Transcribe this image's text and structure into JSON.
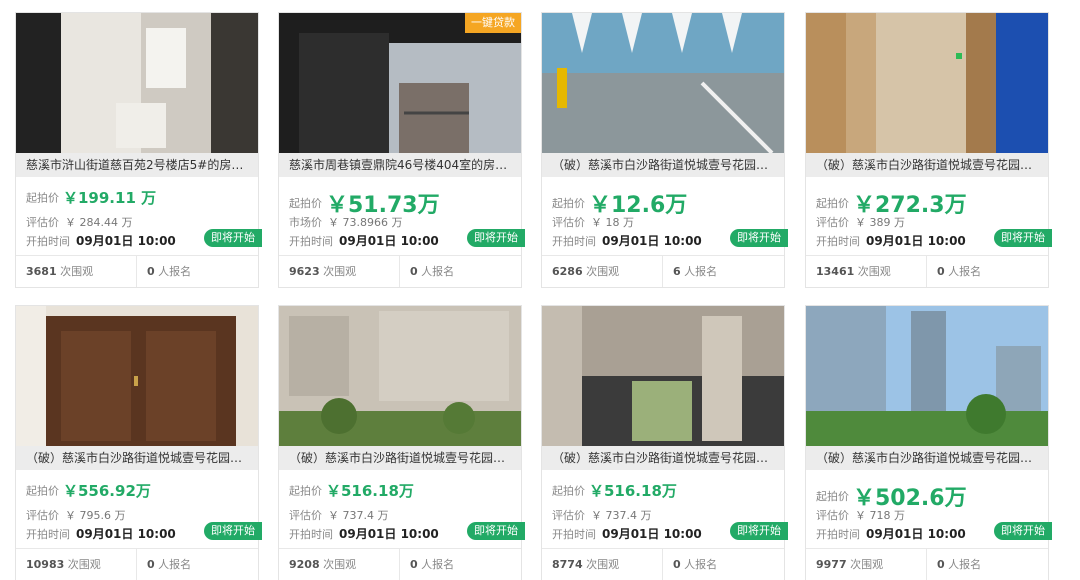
{
  "cards": [
    {
      "title": "慈溪市浒山街道慈百苑2号楼店5#的房…",
      "badge": "",
      "start_label": "起拍价",
      "start_price": "￥199.11 万",
      "est_label": "评估价",
      "est_value": "￥ 284.44 万",
      "time_label": "开拍时间",
      "time_value": "09月01日 10:00",
      "status": "即将开始",
      "views": "3681",
      "views_label": "次围观",
      "signups": "0",
      "signups_label": "人报名"
    },
    {
      "title": "慈溪市周巷镇壹鼎院46号楼404室的房…",
      "badge": "一键贷款",
      "start_label": "起拍价",
      "start_price": "￥51.73万",
      "est_label": "市场价",
      "est_value": "￥ 73.8966 万",
      "time_label": "开拍时间",
      "time_value": "09月01日 10:00",
      "status": "即将开始",
      "views": "9623",
      "views_label": "次围观",
      "signups": "0",
      "signups_label": "人报名"
    },
    {
      "title": "（破）慈溪市白沙路街道悦城壹号花园…",
      "badge": "",
      "start_label": "起拍价",
      "start_price": "￥12.6万",
      "est_label": "评估价",
      "est_value": "￥ 18 万",
      "time_label": "开拍时间",
      "time_value": "09月01日 10:00",
      "status": "即将开始",
      "views": "6286",
      "views_label": "次围观",
      "signups": "6",
      "signups_label": "人报名"
    },
    {
      "title": "（破）慈溪市白沙路街道悦城壹号花园…",
      "badge": "",
      "start_label": "起拍价",
      "start_price": "￥272.3万",
      "est_label": "评估价",
      "est_value": "￥ 389 万",
      "time_label": "开拍时间",
      "time_value": "09月01日 10:00",
      "status": "即将开始",
      "views": "13461",
      "views_label": "次围观",
      "signups": "0",
      "signups_label": "人报名"
    },
    {
      "title": "（破）慈溪市白沙路街道悦城壹号花园…",
      "badge": "",
      "start_label": "起拍价",
      "start_price": "￥556.92万",
      "est_label": "评估价",
      "est_value": "￥ 795.6 万",
      "time_label": "开拍时间",
      "time_value": "09月01日 10:00",
      "status": "即将开始",
      "views": "10983",
      "views_label": "次围观",
      "signups": "0",
      "signups_label": "人报名"
    },
    {
      "title": "（破）慈溪市白沙路街道悦城壹号花园…",
      "badge": "",
      "start_label": "起拍价",
      "start_price": "￥516.18万",
      "est_label": "评估价",
      "est_value": "￥ 737.4 万",
      "time_label": "开拍时间",
      "time_value": "09月01日 10:00",
      "status": "即将开始",
      "views": "9208",
      "views_label": "次围观",
      "signups": "0",
      "signups_label": "人报名"
    },
    {
      "title": "（破）慈溪市白沙路街道悦城壹号花园…",
      "badge": "",
      "start_label": "起拍价",
      "start_price": "￥516.18万",
      "est_label": "评估价",
      "est_value": "￥ 737.4 万",
      "time_label": "开拍时间",
      "time_value": "09月01日 10:00",
      "status": "即将开始",
      "views": "8774",
      "views_label": "次围观",
      "signups": "0",
      "signups_label": "人报名"
    },
    {
      "title": "（破）慈溪市白沙路街道悦城壹号花园…",
      "badge": "",
      "start_label": "起拍价",
      "start_price": "￥502.6万",
      "est_label": "评估价",
      "est_value": "￥ 718 万",
      "time_label": "开拍时间",
      "time_value": "09月01日 10:00",
      "status": "即将开始",
      "views": "9977",
      "views_label": "次围观",
      "signups": "0",
      "signups_label": "人报名"
    }
  ],
  "colors": {
    "accent": "#22aa66",
    "badge": "#f5a623"
  }
}
